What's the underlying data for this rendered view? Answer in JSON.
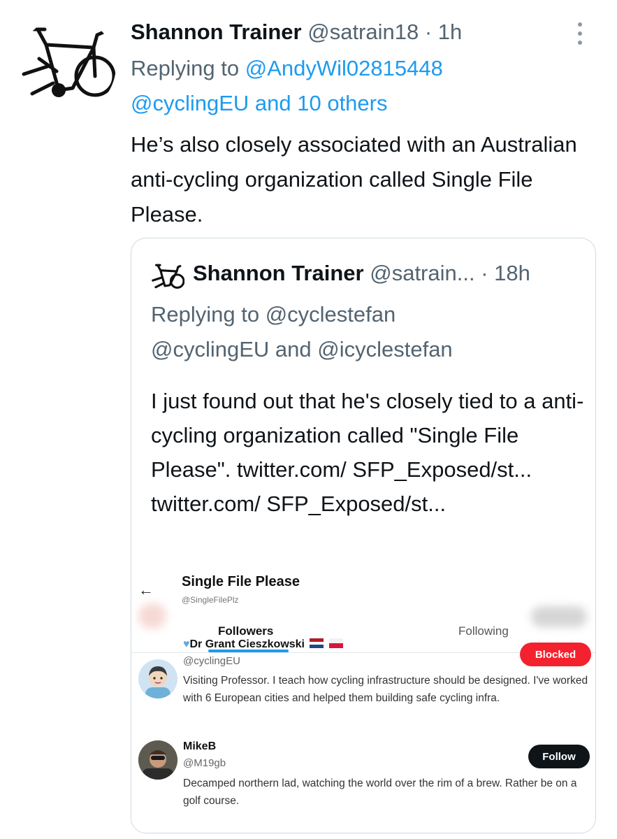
{
  "tweet": {
    "author_name": "Shannon Trainer",
    "author_handle": "@satrain18",
    "time": " · 1h",
    "replying_prefix": "Replying to ",
    "replying_to_1": "@AndyWil02815448",
    "replying_to_2": "@cyclingEU and 10 others",
    "text": "He’s also closely associated with an Australian anti-cycling organization called Single File Please."
  },
  "quoted": {
    "author_name": "Shannon Trainer",
    "author_handle": "@satrain...",
    "time": " · 18h",
    "replying_line1": "Replying to @cyclestefan",
    "replying_line2": "@cyclingEU and @icyclestefan",
    "text": "I just found out that he's closely tied to a anti-cycling organization called \"Single File Please\". twitter.com/ SFP_Exposed/st... twitter.com/ SFP_Exposed/st..."
  },
  "screenshot": {
    "back_arrow": "←",
    "account_name": "Single File Please",
    "account_handle": "@SingleFilePlz",
    "tabs": [
      "Followers",
      "Following"
    ],
    "followers": [
      {
        "name": "Dr Grant Cieszkowski",
        "handle": "@cyclingEU",
        "bio": "Visiting Professor. I teach how cycling infrastructure should be designed. I've worked with 6 European cities and helped them building safe cycling infra.",
        "button": "Blocked",
        "emoji": [
          "blue-heart-icon",
          "netherlands-flag-icon",
          "poland-flag-icon"
        ]
      },
      {
        "name": "MikeB",
        "handle": "@M19gb",
        "bio": "Decamped northern lad, watching the world over the rim of a brew. Rather be on a golf course.",
        "button": "Follow"
      }
    ]
  },
  "colors": {
    "link": "#1d9bf0",
    "secondary_text": "#536471",
    "blocked_button": "#f4212e",
    "follow_button": "#0f1419"
  }
}
